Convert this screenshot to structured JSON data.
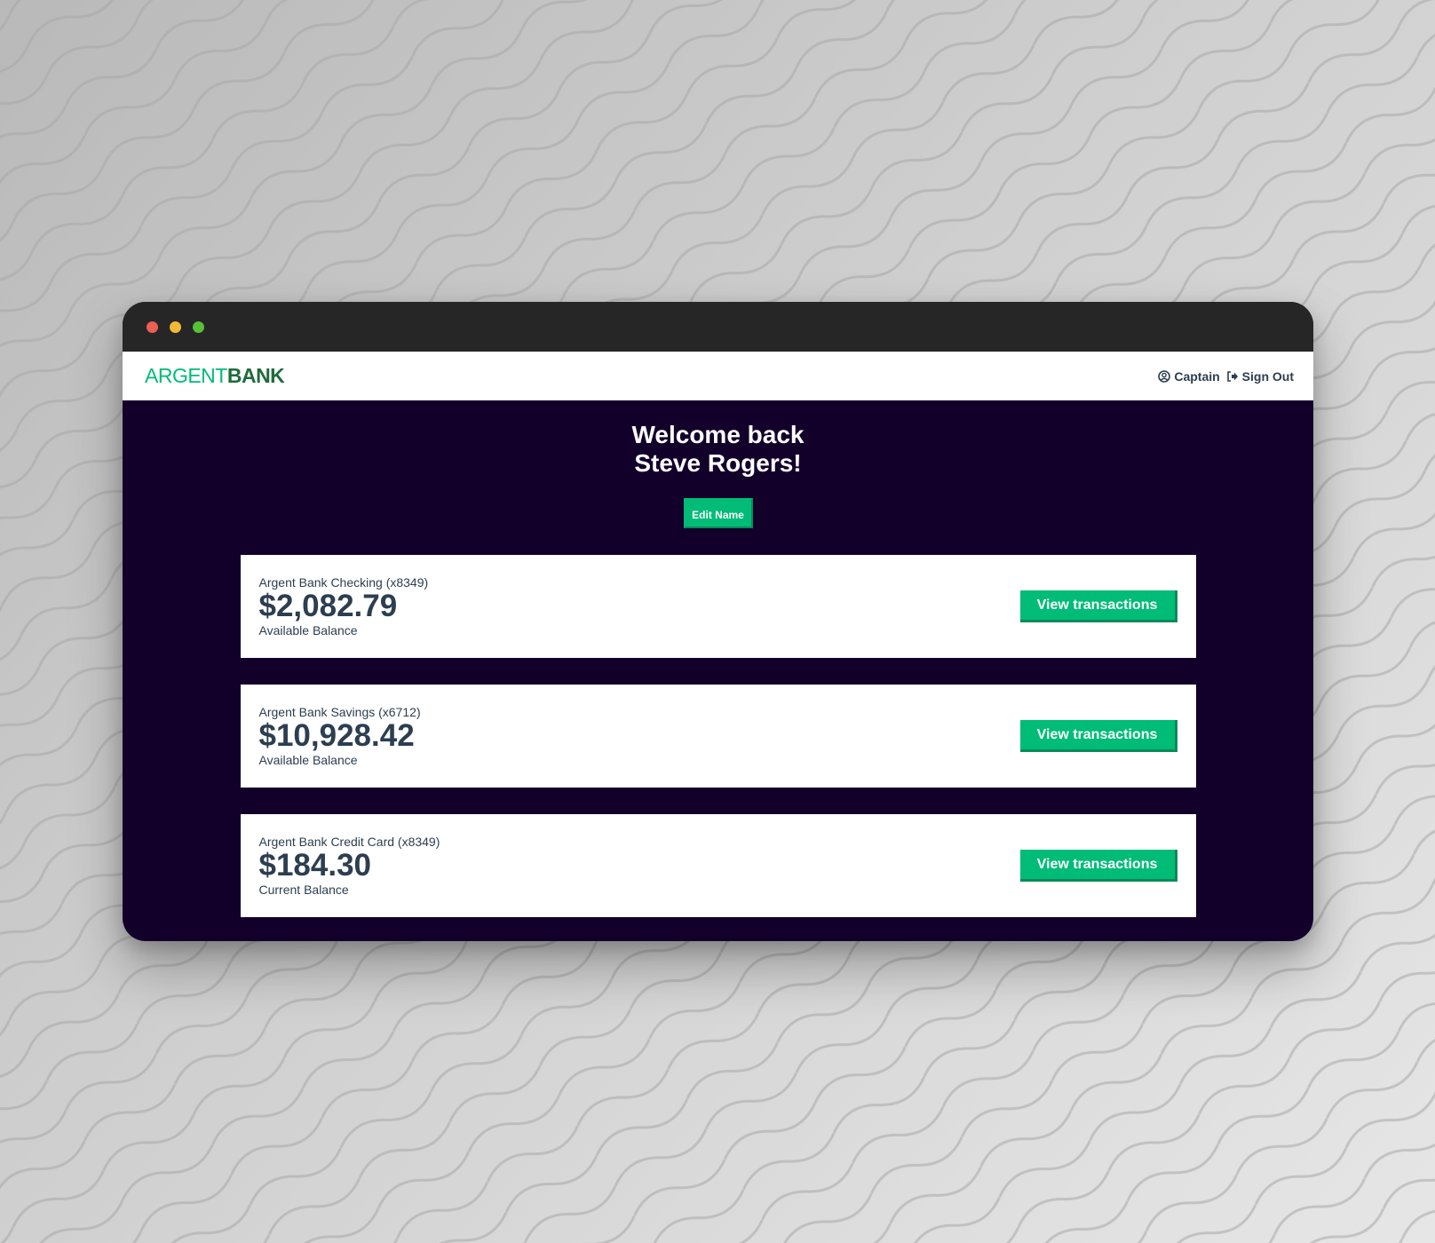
{
  "brand": {
    "logo_part1": "ARGENT",
    "logo_part2": "BANK",
    "accent_color": "#00bc77",
    "logo_dark_color": "#1f6b3c",
    "page_bg_color": "#12002b"
  },
  "nav": {
    "user_label": "Captain",
    "user_icon": "user-circle-icon",
    "signout_label": "Sign Out",
    "signout_icon": "sign-out-icon"
  },
  "header": {
    "welcome_line1": "Welcome back",
    "welcome_line2": "Steve Rogers!",
    "edit_button": "Edit Name"
  },
  "accounts": [
    {
      "title": "Argent Bank Checking (x8349)",
      "amount": "$2,082.79",
      "description": "Available Balance",
      "button": "View transactions"
    },
    {
      "title": "Argent Bank Savings (x6712)",
      "amount": "$10,928.42",
      "description": "Available Balance",
      "button": "View transactions"
    },
    {
      "title": "Argent Bank Credit Card (x8349)",
      "amount": "$184.30",
      "description": "Current Balance",
      "button": "View transactions"
    }
  ]
}
